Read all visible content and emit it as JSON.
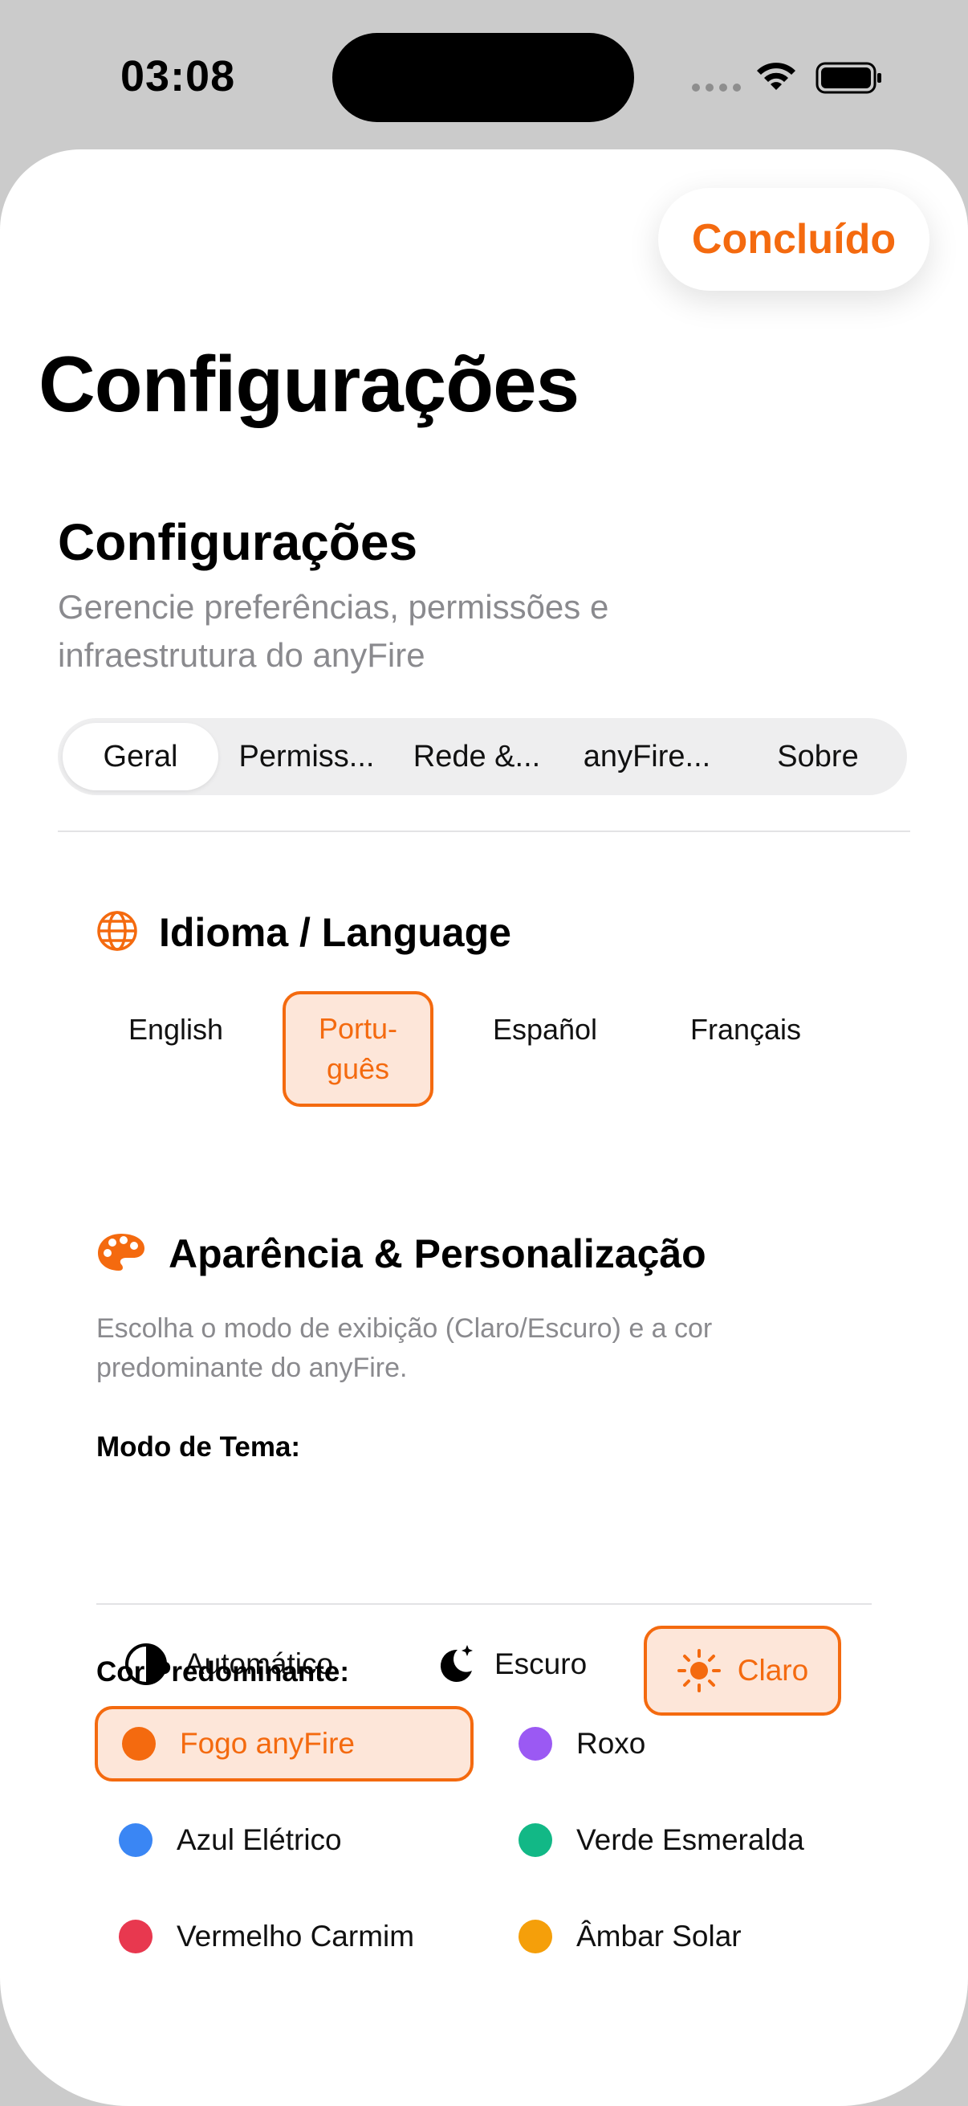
{
  "status_bar": {
    "time": "03:08"
  },
  "header": {
    "done_label": "Concluído",
    "title": "Configurações"
  },
  "section": {
    "title": "Configurações",
    "subtitle": "Gerencie preferências, permissões e infraestrutura do anyFire"
  },
  "tabs": [
    {
      "label": "Geral",
      "active": true
    },
    {
      "label": "Permiss..."
    },
    {
      "label": "Rede &..."
    },
    {
      "label": "anyFire..."
    },
    {
      "label": "Sobre"
    }
  ],
  "language": {
    "title": "Idioma / Language",
    "icon": "globe-icon",
    "options": [
      "English",
      "Portu-\nguês",
      "Español",
      "Français"
    ],
    "selected": "Portu-\nguês"
  },
  "appearance": {
    "title": "Aparência & Personalização",
    "icon": "palette-icon",
    "description": "Escolha o modo de exibição (Claro/Escuro) e a cor predominante do anyFire.",
    "theme_label": "Modo de Tema:",
    "themes": [
      {
        "label": "Automático",
        "icon": "half-circle-icon"
      },
      {
        "label": "Escuro",
        "icon": "moon-stars-icon"
      },
      {
        "label": "Claro",
        "icon": "sun-icon",
        "active": true
      }
    ],
    "color_label": "Cor Predominante:",
    "colors": [
      {
        "label": "Fogo anyFire",
        "color": "#f46a0f",
        "active": true
      },
      {
        "label": "Roxo",
        "color": "#9b59f3"
      },
      {
        "label": "Azul Elétrico",
        "color": "#3a86f4"
      },
      {
        "label": "Verde Esmeralda",
        "color": "#12b886"
      },
      {
        "label": "Vermelho Carmim",
        "color": "#e8384f"
      },
      {
        "label": "Âmbar Solar",
        "color": "#f59f0a"
      }
    ]
  },
  "accent_color": "#f46a0f"
}
